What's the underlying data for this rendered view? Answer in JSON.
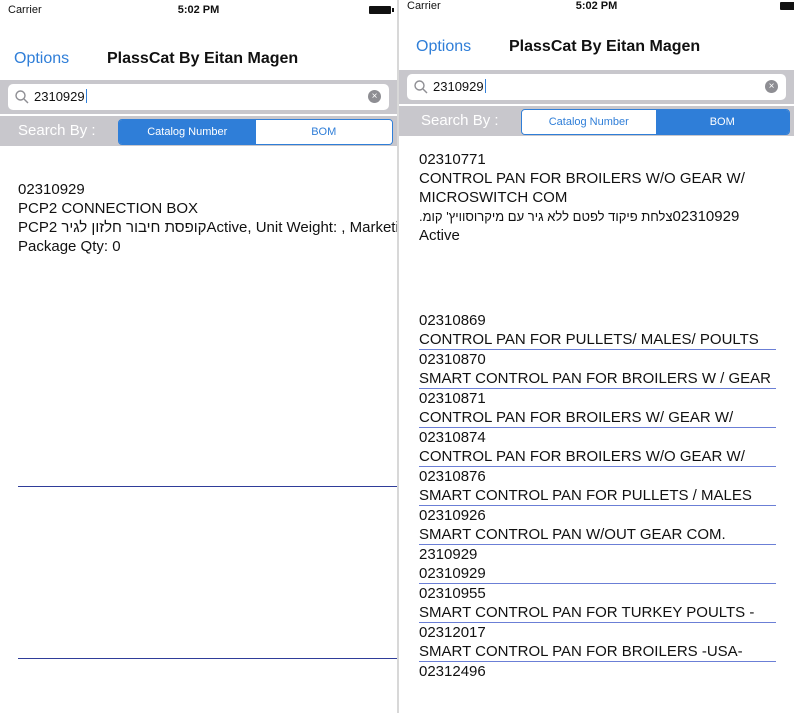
{
  "status": {
    "carrier": "Carrier",
    "time": "5:02 PM"
  },
  "nav": {
    "options": "Options",
    "title": "PlassCat By Eitan Magen"
  },
  "search": {
    "value": "2310929"
  },
  "scope": {
    "label": "Search By :",
    "catalog": "Catalog Number",
    "bom": "BOM"
  },
  "left_detail": {
    "number": "02310929",
    "name": "PCP2 CONNECTION BOX",
    "hebrew": "קופסת חיבור חלזון לגיר PCP2",
    "info": "Active, Unit Weight: , Marketing Package : MAS",
    "qty": "Package Qty:  0"
  },
  "right_header": {
    "number": "02310771",
    "name_line1": "CONTROL PAN FOR BROILERS W/O GEAR W/",
    "name_line2": "MICROSWITCH COM",
    "hebrew": "צלחת פיקוד לפטם ללא גיר עם מיקרוסוויץ' קומ.",
    "search_number": "02310929",
    "status": "Active"
  },
  "bom_items": [
    {
      "number": "02310869",
      "name": "CONTROL PAN FOR PULLETS/ MALES/ POULTS"
    },
    {
      "number": "02310870",
      "name": "SMART CONTROL PAN FOR BROILERS W / GEAR"
    },
    {
      "number": "02310871",
      "name": "CONTROL PAN FOR BROILERS W/ GEAR W/"
    },
    {
      "number": "02310874",
      "name": "CONTROL PAN FOR BROILERS W/O GEAR W/"
    },
    {
      "number": "02310876",
      "name": "SMART CONTROL PAN FOR PULLETS / MALES"
    },
    {
      "number": "02310926",
      "name": "SMART CONTROL PAN W/OUT GEAR COM."
    },
    {
      "number": "2310929",
      "name": "02310929"
    },
    {
      "number": "02310955",
      "name": "SMART CONTROL PAN FOR TURKEY POULTS -"
    },
    {
      "number": "02312017",
      "name": "SMART CONTROL PAN FOR BROILERS -USA-"
    },
    {
      "number": "02312496",
      "name": ""
    }
  ]
}
